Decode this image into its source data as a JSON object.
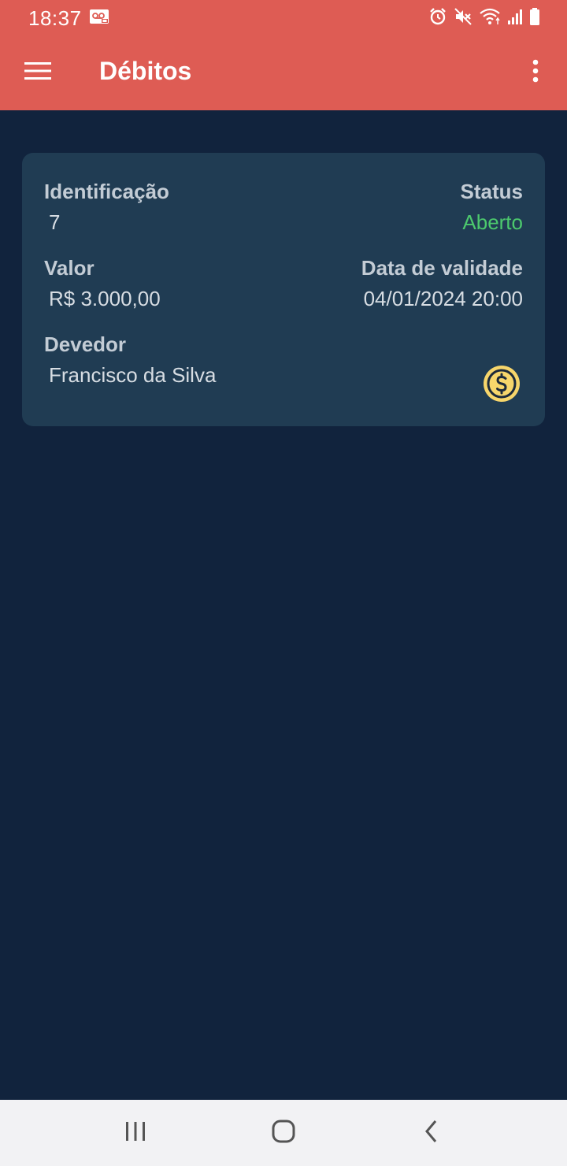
{
  "status_bar": {
    "time": "18:37",
    "icons": [
      "voicemail-icon",
      "alarm-icon",
      "mute-icon",
      "wifi-icon",
      "signal-icon",
      "battery-icon"
    ]
  },
  "app_bar": {
    "title": "Débitos",
    "background_color": "#de5c54",
    "icons": [
      "menu-icon",
      "more-vert-icon"
    ]
  },
  "debt_card": {
    "identification_label": "Identificação",
    "identification_value": "7",
    "status_label": "Status",
    "status_value": "Aberto",
    "status_color": "#4cc96d",
    "amount_label": "Valor",
    "amount_value": "R$ 3.000,00",
    "due_date_label": "Data de validade",
    "due_date_value": "04/01/2024 20:00",
    "debtor_label": "Devedor",
    "debtor_value": "Francisco da Silva",
    "action_icon": "dollar-coin-icon",
    "action_icon_color": "#f7d66b"
  },
  "nav_bar": {
    "icons": [
      "recent-apps-icon",
      "home-icon",
      "back-icon"
    ]
  },
  "colors": {
    "background": "#11233d",
    "card": "#203c53"
  }
}
